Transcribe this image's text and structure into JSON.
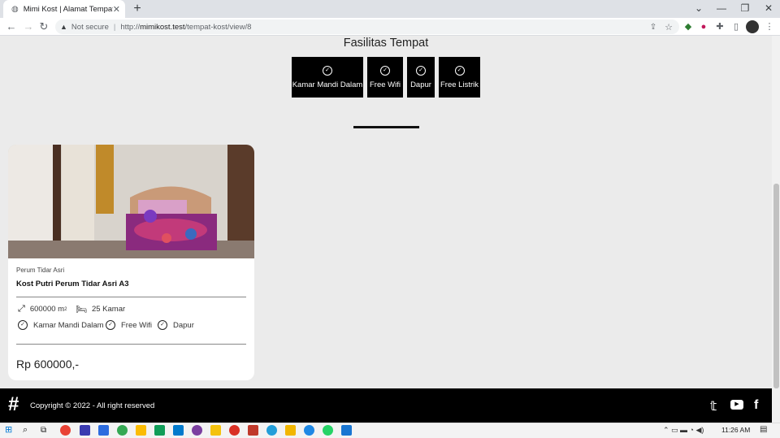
{
  "browser": {
    "tab_title": "Mimi Kost | Alamat Tempat Kost",
    "tab_close": "✕",
    "new_tab": "+",
    "security_label": "Not secure",
    "url_scheme": "http://",
    "url_host": "mimikost.test",
    "url_path": "/tempat-kost/view/8"
  },
  "facilities": {
    "heading": "Fasilitas Tempat",
    "items": [
      "Kamar Mandi Dalam",
      "Free Wifi",
      "Dapur",
      "Free Listrik"
    ]
  },
  "card": {
    "area_name": "Perum Tidar Asri",
    "title": "Kost Putri Perum Tidar Asri A3",
    "size_value": "600000 m",
    "size_unit_sup": "2",
    "rooms": "25 Kamar",
    "features": [
      "Kamar Mandi Dalam",
      "Free Wifi",
      "Dapur"
    ],
    "price": "Rp 600000,-"
  },
  "footer": {
    "copyright": "Copyright © 2022 - All right reserved"
  },
  "taskbar": {
    "time": "11:26 AM"
  },
  "colors": {
    "page_bg": "#ebebeb",
    "facility_bg": "#000000",
    "footer_bg": "#000000",
    "card_bg": "#ffffff"
  }
}
